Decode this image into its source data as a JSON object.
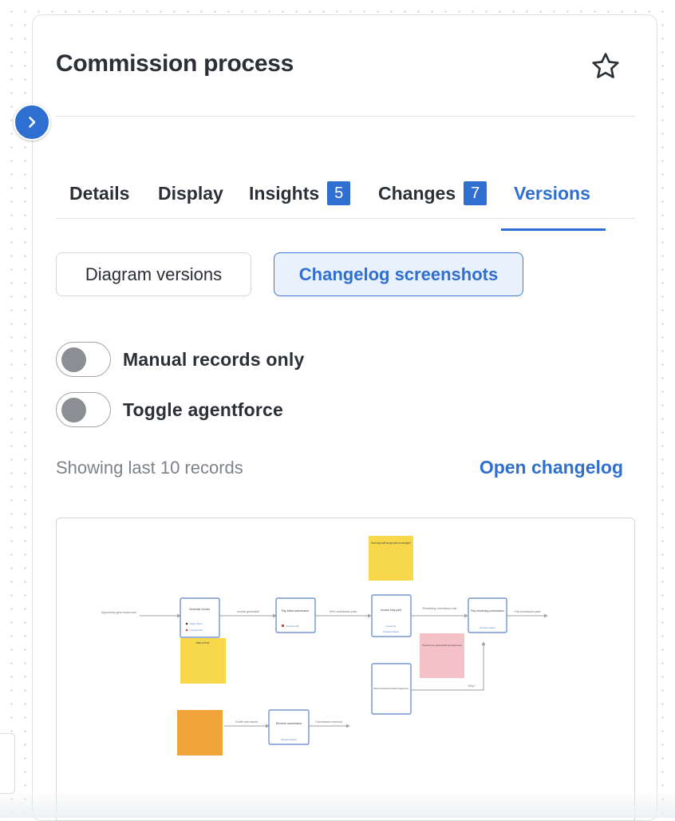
{
  "panel": {
    "title": "Commission process",
    "favorite_icon": "star-outline-icon",
    "collapse_icon": "chevron-right-icon"
  },
  "tabs": [
    {
      "label": "Details"
    },
    {
      "label": "Display"
    },
    {
      "label": "Insights",
      "badge": "5"
    },
    {
      "label": "Changes",
      "badge": "7"
    },
    {
      "label": "Versions",
      "active": true
    }
  ],
  "segments": {
    "diagram_versions": "Diagram versions",
    "changelog_screenshots": "Changelog screenshots",
    "selected": "changelog_screenshots"
  },
  "toggles": [
    {
      "label": "Manual records only",
      "on": false
    },
    {
      "label": "Toggle agentforce",
      "on": false
    }
  ],
  "records": {
    "showing_text": "Showing last 10 records",
    "open_changelog": "Open changelog"
  },
  "colors": {
    "accent": "#2f6fd1",
    "accent_bg": "#e9f1fc",
    "sticky_yellow": "#f7d84a",
    "sticky_pink": "#f4c1c6",
    "sticky_orange": "#f0a43a"
  },
  "screenshot": {
    "start_label": "Opportunity gets closed-won",
    "boxes": [
      {
        "title": "Generate invoice",
        "tags": [
          "Sales Team",
          "Finance Ra"
        ]
      },
      {
        "title": "Pay initial commission",
        "tags": [
          "Finance RA"
        ]
      },
      {
        "title": "Invoice fully paid",
        "tags": [
          "Customer",
          "Finance Depar"
        ]
      },
      {
        "title": "Pay remaining commission",
        "tags": [
          "Finance Depar"
        ]
      },
      {
        "title": "Estimate the commission based on past activity and engagement scores",
        "tags": []
      },
      {
        "title": "Reverse commission",
        "tags": [
          "Finance Depar"
        ]
      }
    ],
    "edge_labels": [
      "Invoice generated",
      "50% commission paid",
      "Remaining commission due",
      "Full commission paid",
      "Why?",
      "Credit note issued",
      "Commission reversed"
    ],
    "notes": [
      "How long until we get paid on average?",
      "Also a true",
      "This has to be confirmed with the finance team"
    ]
  }
}
